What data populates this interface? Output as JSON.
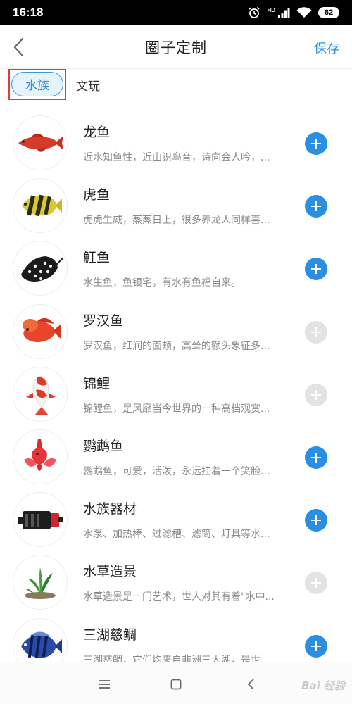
{
  "status_bar": {
    "time": "16:18",
    "hd_label": "HD",
    "battery": "62",
    "icons": [
      "alarm-icon",
      "signal-icon",
      "wifi-icon",
      "battery-icon"
    ]
  },
  "header": {
    "title": "圈子定制",
    "save_label": "保存",
    "back_icon": "chevron-left-icon"
  },
  "tabs": [
    {
      "label": "水族",
      "active": true
    },
    {
      "label": "文玩",
      "active": false
    }
  ],
  "items": [
    {
      "name": "龙鱼",
      "desc": "近水知鱼性，近山识鸟音，诗向会人吟，...",
      "added": false,
      "icon": "arowana-icon"
    },
    {
      "name": "虎鱼",
      "desc": "虎虎生威，蒸蒸日上，很多养龙人同样喜...",
      "added": false,
      "icon": "tiger-fish-icon"
    },
    {
      "name": "魟鱼",
      "desc": "水生鱼，鱼镇宅，有水有鱼福自来。",
      "added": false,
      "icon": "stingray-icon"
    },
    {
      "name": "罗汉鱼",
      "desc": "罗汉鱼，红润的面颊，高耸的额头象征多...",
      "added": true,
      "icon": "flowerhorn-icon"
    },
    {
      "name": "锦鲤",
      "desc": "锦鲤鱼，是风靡当今世界的一种高档观赏...",
      "added": true,
      "icon": "koi-icon"
    },
    {
      "name": "鹦鹉鱼",
      "desc": "鹦鹉鱼，可爱，活泼，永远挂着一个笑脸...",
      "added": false,
      "icon": "parrot-fish-icon"
    },
    {
      "name": "水族器材",
      "desc": "水泵、加热棒、过滤槽、滤筒、灯具等水...",
      "added": false,
      "icon": "water-pump-icon"
    },
    {
      "name": "水草造景",
      "desc": "水草造景是一门艺术，世人对其有着\"水中...",
      "added": true,
      "icon": "aquatic-plant-icon"
    },
    {
      "name": "三湖慈鲷",
      "desc": "三湖慈鲷，它们均来自非洲三大湖，是世...",
      "added": false,
      "icon": "cichlid-icon"
    }
  ],
  "nav_bar": {
    "icons": [
      "menu-icon",
      "home-square-icon",
      "back-triangle-icon"
    ],
    "watermark": "Bai 经验"
  },
  "colors": {
    "accent": "#2a8fe3",
    "added_disabled": "#e3e3e3",
    "highlight_frame": "#e03a3a"
  }
}
